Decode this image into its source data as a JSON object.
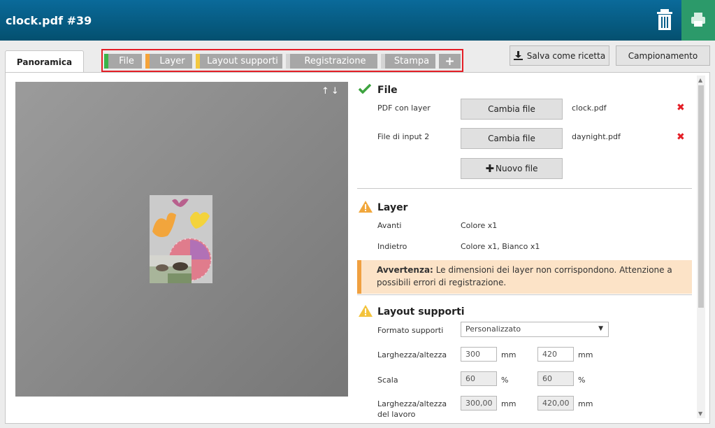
{
  "window": {
    "title": "clock.pdf #39"
  },
  "tabs": {
    "active": "Panoramica",
    "steps": [
      {
        "label": "File",
        "color": "#3cb44a"
      },
      {
        "label": "Layer",
        "color": "#f5a33a"
      },
      {
        "label": "Layout supporti",
        "color": "#f3c840"
      },
      {
        "label": "Registrazione",
        "color": "#d4d4d4"
      },
      {
        "label": "Stampa",
        "color": "#d4d4d4"
      }
    ],
    "add": "+"
  },
  "header_buttons": {
    "save_recipe": "Salva come ricetta",
    "sampling": "Campionamento"
  },
  "preview": {
    "toggle": "↑↓"
  },
  "file_section": {
    "title": "File",
    "rows": [
      {
        "label": "PDF con layer",
        "button": "Cambia file",
        "filename": "clock.pdf"
      },
      {
        "label": "File di input 2",
        "button": "Cambia file",
        "filename": "daynight.pdf"
      }
    ],
    "new_file": "Nuovo file"
  },
  "layer_section": {
    "title": "Layer",
    "rows": [
      {
        "label": "Avanti",
        "value": "Colore x1"
      },
      {
        "label": "Indietro",
        "value": "Colore x1, Bianco x1"
      }
    ],
    "warning_prefix": "Avvertenza:",
    "warning_text": "Le dimensioni dei layer non corrispondono. Attenzione a possibili errori di registrazione."
  },
  "layout_section": {
    "title": "Layout supporti",
    "format_label": "Formato supporti",
    "format_value": "Personalizzato",
    "size_label": "Larghezza/altezza",
    "width": "300",
    "height": "420",
    "unit_mm": "mm",
    "scale_label": "Scala",
    "scale_w": "60",
    "scale_h": "60",
    "unit_pct": "%",
    "work_label_1": "Larghezza/altezza",
    "work_label_2": "del lavoro",
    "work_w": "300,00",
    "work_h": "420,00"
  }
}
